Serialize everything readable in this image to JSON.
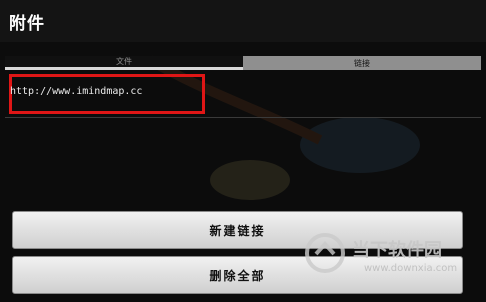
{
  "header": {
    "title": "附件"
  },
  "tabs": [
    {
      "label": "文件"
    },
    {
      "label": "链接"
    }
  ],
  "attachments": {
    "link_url": "http://www.imindmap.cc"
  },
  "actions": {
    "new_link_label": "新建链接",
    "delete_all_label": "删除全部"
  },
  "watermark": {
    "brand": "当下软件园",
    "url": "www.downxia.com"
  },
  "colors": {
    "highlight_border": "#e01616",
    "active_tab_bg": "#8f8f8f"
  }
}
